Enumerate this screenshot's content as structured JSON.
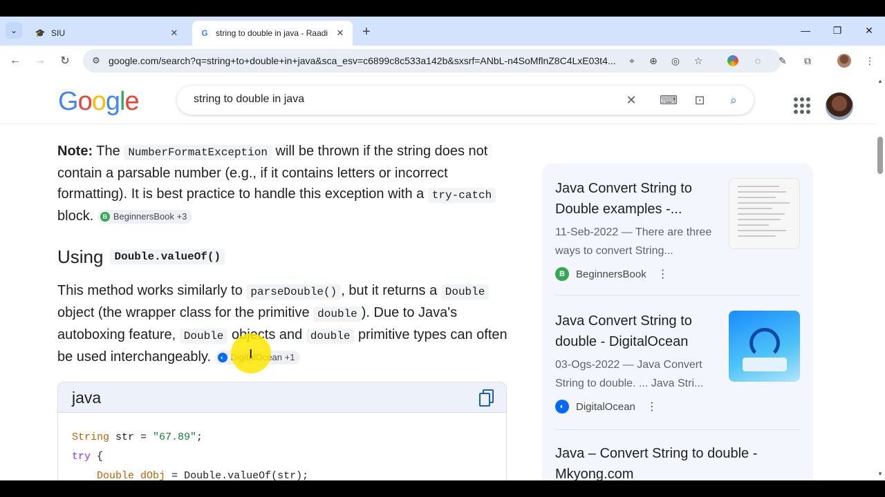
{
  "browser": {
    "tabs": [
      {
        "title": "SIU",
        "icon": "graduation-cap-icon"
      },
      {
        "title": "string to double in java - Raadi",
        "icon": "google-g-icon"
      }
    ],
    "url": "google.com/search?q=string+to+double+in+java&sca_esv=c6899c8c533a142b&sxsrf=ANbL-n4SoMflnZ8C4LxE03t4..."
  },
  "google": {
    "logo": [
      "G",
      "o",
      "o",
      "g",
      "l",
      "e"
    ],
    "logo_colors": [
      "#4285f4",
      "#ea4335",
      "#fbbc05",
      "#4285f4",
      "#34a853",
      "#ea4335"
    ],
    "query": "string to double in java"
  },
  "main": {
    "note": {
      "label": "Note:",
      "t1": " The ",
      "c1": "NumberFormatException",
      "t2": " will be thrown if the string does not contain a parsable number (e.g., if it contains letters or incorrect formatting). It is best practice to handle this exception with a ",
      "c2": "try-catch",
      "t3": " block. ",
      "chip": "BeginnersBook +3"
    },
    "heading": {
      "text": "Using",
      "code": "Double.valueOf()"
    },
    "para": {
      "t1": "This method works similarly to ",
      "c1": "parseDouble()",
      "t2": ", but it returns a ",
      "c2": "Double",
      "t3": " object (the wrapper class for the primitive ",
      "c3": "double",
      "t4": "). Due to Java's autoboxing feature, ",
      "c4": "Double",
      "t5": " objects and ",
      "c5": "double",
      "t6": " primitive types can often be used interchangeably. ",
      "chip": "DigitalOcean +1"
    },
    "code": {
      "lang": "java",
      "line1_type": "String",
      "line1_rest": " str = ",
      "line1_str": "\"67.89\"",
      "line1_end": ";",
      "line2_kw": "try",
      "line2_rest": " {",
      "line3_type": "Double",
      "line3_var": "dObj",
      "line3_rest": " = Double.valueOf(str);"
    }
  },
  "sidebar": {
    "cards": [
      {
        "title": "Java Convert String to Double examples -...",
        "snippet": "11-Seb-2022 — There are three ways to convert String...",
        "source": "BeginnersBook",
        "source_color": "#34a853"
      },
      {
        "title": "Java Convert String to double - DigitalOcean",
        "snippet": "03-Ogs-2022 — Java Convert String to double. ... Java Stri...",
        "source": "DigitalOcean",
        "source_color": "#0069ff"
      },
      {
        "title": "Java – Convert String to double - Mkyong.com"
      }
    ]
  }
}
